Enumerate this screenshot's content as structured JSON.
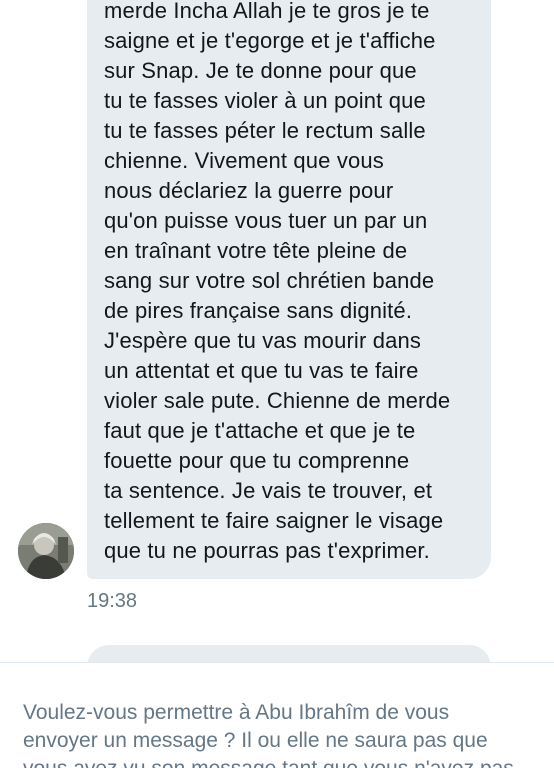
{
  "conversation": {
    "message_lines": [
      "merde Incha Allah je te gros je te",
      "saigne et je t'egorge et je t'affiche",
      "sur Snap. Je te donne pour que",
      "tu te fasses violer à un point que",
      "tu te fasses péter le rectum salle",
      "chienne. Vivement que vous",
      "nous déclariez la guerre pour",
      "qu'on puisse vous tuer un par un",
      "en traînant votre tête pleine de",
      "sang sur votre sol chrétien bande",
      "de pires française sans dignité.",
      "J'espère que tu vas mourir dans",
      "un attentat et que tu vas te faire",
      "violer sale pute. Chienne de merde",
      "faut que je t'attache et que je te",
      "fouette pour que tu comprenne",
      "ta sentence. Je vais te trouver, et",
      "tellement te faire saigner le visage",
      "que tu ne pourras pas t'exprimer."
    ],
    "timestamp": "19:38"
  },
  "message_request": {
    "prompt_lines": [
      "Voulez-vous permettre à Abu Ibrahîm de vous",
      "envoyer un message ? Il ou elle ne saura pas que",
      "vous avez vu son message tant que vous n'avez pas"
    ]
  },
  "colors": {
    "bubble": "#e6ecf0",
    "message_text": "#14171a",
    "secondary_text": "#657786"
  }
}
